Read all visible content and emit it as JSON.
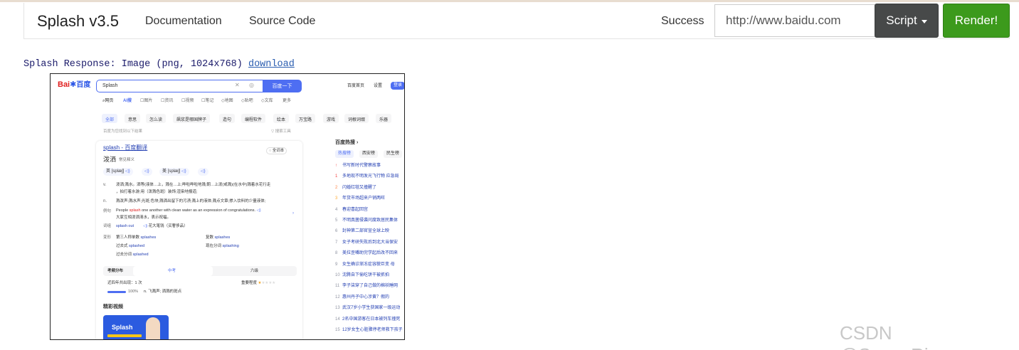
{
  "navbar": {
    "brand": "Splash v3.5",
    "links": [
      "Documentation",
      "Source Code"
    ],
    "status": "Success",
    "url_value": "http://www.baidu.com",
    "script_label": "Script",
    "render_label": "Render!"
  },
  "response": {
    "prefix": "Splash Response: ",
    "kind": "Image",
    "meta": " (png, 1024x768) ",
    "download_label": "download"
  },
  "watermark": "CSDN @SunnyRivers",
  "baidu": {
    "logo_bai": "Bai",
    "logo_du": "百度",
    "query": "Splash",
    "search_button": "百度一下",
    "top_links": [
      "百度首页",
      "设置",
      "登录"
    ],
    "tabs": [
      "网页",
      "AI搜",
      "图片",
      "资讯",
      "视频",
      "笔记",
      "地图",
      "贴吧",
      "文库",
      "更多"
    ],
    "filters": [
      "全部",
      "意思",
      "怎么读",
      "飙浆是哪国牌子",
      "造句",
      "编程软件",
      "绘本",
      "万宝路",
      "游戏",
      "词根词缀",
      "乐器"
    ],
    "result_count": "百度为您找到以下结果",
    "search_tools": "搜索工具",
    "result_title": "splash - 百度翻译",
    "full_entry": "全词本",
    "word": "泼洒",
    "common": "常见释义",
    "phon_uk": "英 [splæʃ]",
    "phon_us": "美 [splæʃ]",
    "def_v_label": "v.",
    "def_v": "泼洒;溅水。洒等(液体…上，溅在…上;哗啦哗啦地溅;朝…上泼(或溅)(在水中)溅着水花行走",
    "def_v2": "，拍打着水游;用（泼溅色斑）装饰;渲染地报道;",
    "def_n_label": "n.",
    "def_n": "溅泼声;溅水声;光斑;色块;溅洒出留下的污渍;溅上的液体;溅点文章;掺入饮料的少量液体;",
    "example_label": "例句",
    "example_en_1": "People ",
    "example_en_hl": "splash",
    "example_en_2": " one another with clean water as an expression of congratulations.",
    "example_zh": "大家互相泼洒清水，表示祝福。",
    "phrase_label": "词组",
    "phrase": "splash out",
    "phrase_zh": "花大笔钱（买奢侈品）",
    "forms_label": "变形",
    "forms": [
      {
        "k": "第三人称单数",
        "v": "splashes"
      },
      {
        "k": "复数",
        "v": "splashes"
      },
      {
        "k": "过去式",
        "v": "splashed"
      },
      {
        "k": "现在分词",
        "v": "splashing"
      },
      {
        "k": "过去分词",
        "v": "splashed"
      }
    ],
    "exam_tabs": [
      "考频分布",
      "中考",
      "六级"
    ],
    "exam_line1": "近四年共出现：1 次",
    "importance": "重要程度",
    "exam_pct": "100%",
    "exam_def": "n. 飞溅声; 洒溅的斑点",
    "video_heading": "精彩视频",
    "video_title": "Splash",
    "hot_title": "百度热搜",
    "hot_tabs": [
      "热搜榜",
      "西安榜",
      "民生榜"
    ],
    "hot_items": [
      {
        "n": "",
        "t": "书写新时代警察故事"
      },
      {
        "n": "1",
        "t": "多地现不明发光飞行物 应急局"
      },
      {
        "n": "2",
        "t": "闪婚红毯又撞醒了"
      },
      {
        "n": "3",
        "t": "年货市场超来户销两旺"
      },
      {
        "n": "4",
        "t": "春迎喜起回宫"
      },
      {
        "n": "5",
        "t": "不明真菌侵袭问度致居民集体"
      },
      {
        "n": "6",
        "t": "封神第二部官宣全球上映"
      },
      {
        "n": "7",
        "t": "女子考研失败后到北大当保安"
      },
      {
        "n": "8",
        "t": "美拉歪嘴助完学起后改不回来"
      },
      {
        "n": "9",
        "t": "女生确诊渐冻症容貌巨变 母"
      },
      {
        "n": "10",
        "t": "沈腾自下偷吃饼干被抓拍"
      },
      {
        "n": "11",
        "t": "李子柒穿了自己做的棉袄睡网"
      },
      {
        "n": "12",
        "t": "惠州丹子中心涉黄？假的"
      },
      {
        "n": "13",
        "t": "武汉7岁小学生获国家一级运动"
      },
      {
        "n": "14",
        "t": "2名中国游客在日本被列车撞死"
      },
      {
        "n": "15",
        "t": "12岁女生心脏骤停老师救下孩子"
      }
    ]
  }
}
